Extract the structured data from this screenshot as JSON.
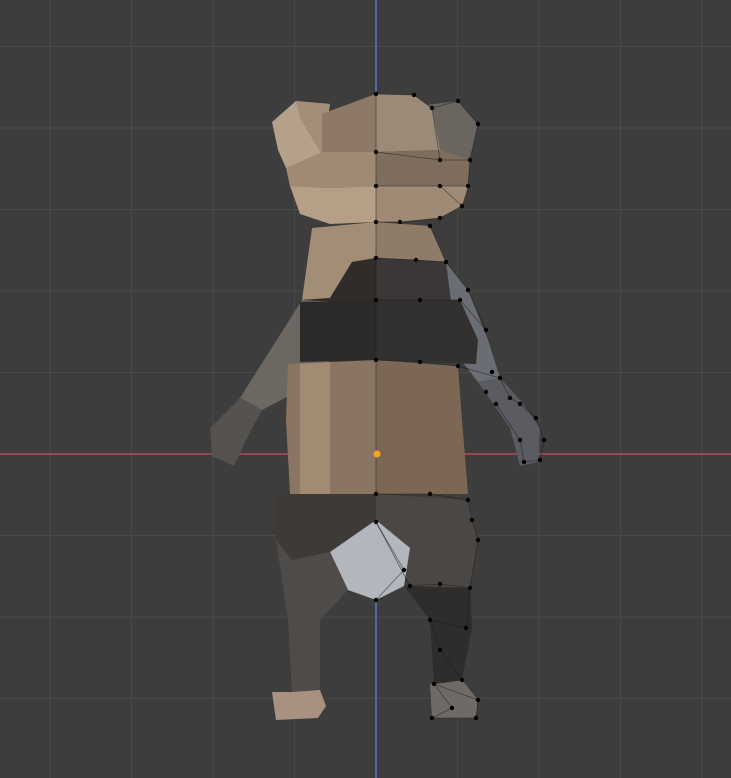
{
  "viewport": {
    "mode": "edit-mode",
    "view": "front-orthographic"
  },
  "colors": {
    "background": "#3d3d3d",
    "grid_line": "#4a4a4a",
    "grid_line_major": "#505050",
    "x_axis": "#b34d54",
    "z_axis": "#4a7ec4",
    "origin": "#ffa31a",
    "vertex": "#000000",
    "mesh_light": "#b09a82",
    "mesh_mid": "#8a7561",
    "mesh_dark": "#3a3633",
    "mesh_shadow": "#2a2826",
    "mesh_side": "#5f6168"
  },
  "icons": {
    "origin": "object-origin-icon",
    "model": "bear-mesh-icon"
  }
}
